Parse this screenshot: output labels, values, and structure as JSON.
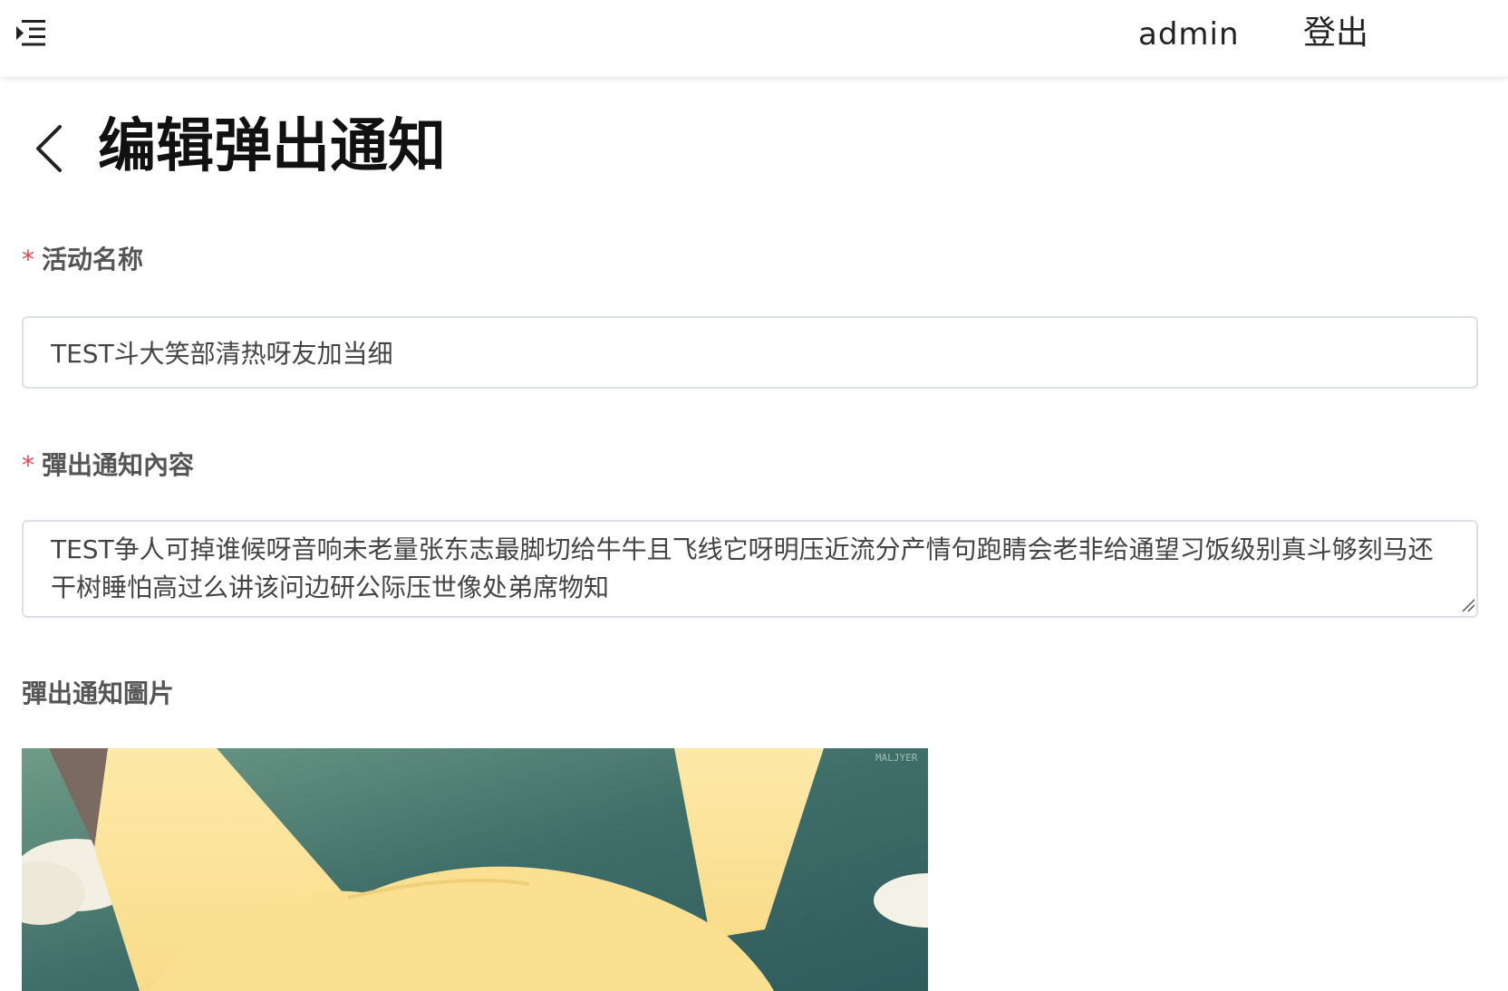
{
  "header": {
    "menu_icon": "indent-menu-icon",
    "username": "admin",
    "logout_label": "登出"
  },
  "page": {
    "back_icon": "chevron-left-icon",
    "title": "编辑弹出通知"
  },
  "form": {
    "activity_name": {
      "label": "活动名称",
      "required": true,
      "value": "TEST斗大笑部清热呀友加当细"
    },
    "content": {
      "label": "彈出通知內容",
      "required": true,
      "value": "TEST争人可掉谁候呀音响未老量张东志最脚切给牛牛且飞线它呀明压近流分产情句跑睛会老非给通望习饭级别真斗够刻马还干树睡怕高过么讲该问边研公际压世像处弟席物知"
    },
    "image": {
      "label": "彈出通知圖片",
      "required": false,
      "watermark": "MALJYER"
    }
  },
  "colors": {
    "required_marker": "#e5484d",
    "label_text": "#555555",
    "input_border": "#dcdfe6"
  }
}
